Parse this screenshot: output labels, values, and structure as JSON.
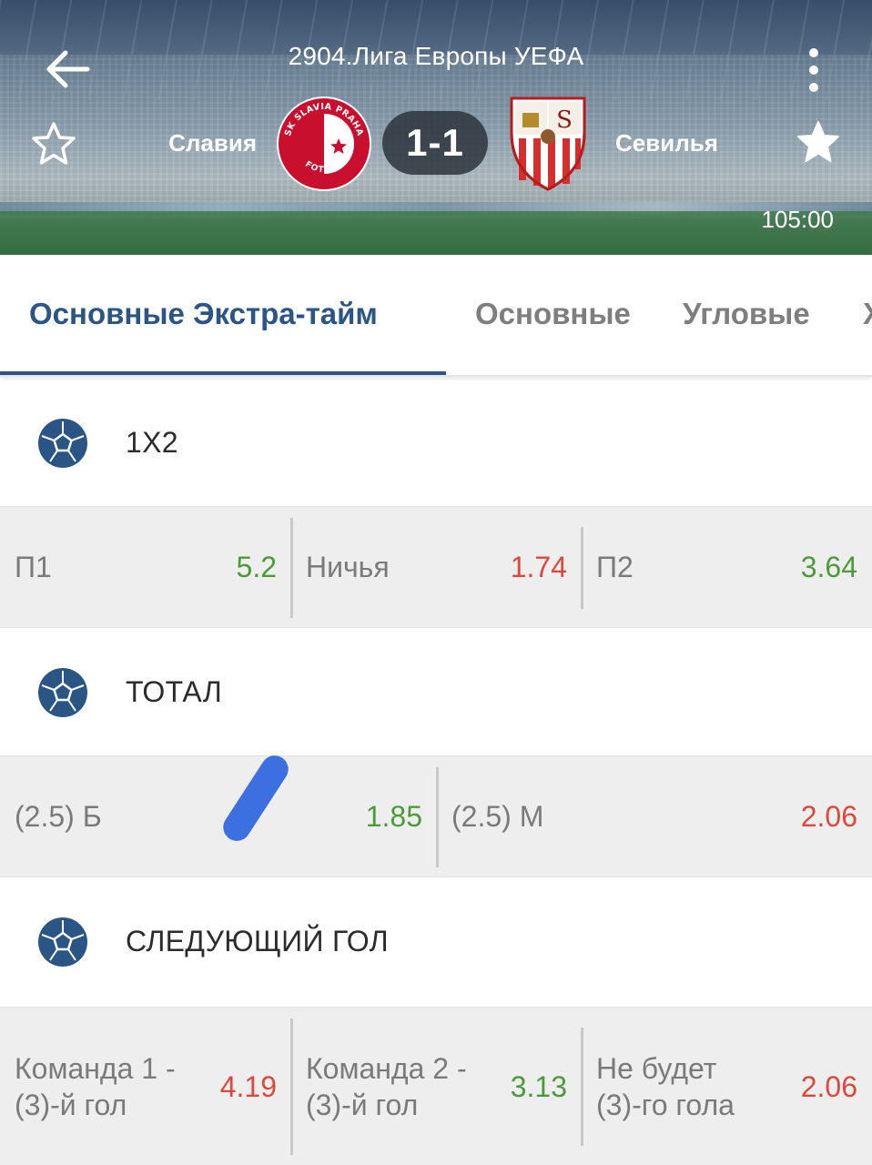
{
  "header": {
    "league": "2904.Лига Европы УЕФА",
    "home_team": "Славия",
    "away_team": "Севилья",
    "score": "1-1",
    "time": "105:00",
    "home_logo_text": "SK SLAVIA PRAHA FOTBAL"
  },
  "tabs": [
    {
      "label": "Основные Экстра-тайм",
      "active": true
    },
    {
      "label": "Основные",
      "active": false
    },
    {
      "label": "Угловые",
      "active": false
    },
    {
      "label": "Х",
      "active": false
    }
  ],
  "markets": [
    {
      "title": "1Х2",
      "outcomes": [
        {
          "label": "П1",
          "odd": "5.2",
          "trend": "up"
        },
        {
          "label": "Ничья",
          "odd": "1.74",
          "trend": "down"
        },
        {
          "label": "П2",
          "odd": "3.64",
          "trend": "up"
        }
      ]
    },
    {
      "title": "ТОТАЛ",
      "outcomes": [
        {
          "label": "(2.5) Б",
          "odd": "1.85",
          "trend": "up"
        },
        {
          "label": "(2.5) М",
          "odd": "2.06",
          "trend": "down"
        }
      ]
    },
    {
      "title": "СЛЕДУЮЩИЙ ГОЛ",
      "outcomes": [
        {
          "label_line1": "Команда 1 -",
          "label_line2": "(3)-й гол",
          "odd": "4.19",
          "trend": "down"
        },
        {
          "label_line1": "Команда 2 -",
          "label_line2": "(3)-й гол",
          "odd": "3.13",
          "trend": "up"
        },
        {
          "label_line1": "Не будет",
          "label_line2": "(3)-го гола",
          "odd": "2.06",
          "trend": "down"
        }
      ]
    }
  ],
  "colors": {
    "accent": "#2a5585",
    "odd_up": "#4d9a3c",
    "odd_down": "#d94a3d",
    "row_bg": "#eeeeee"
  },
  "icons": [
    "arrow-left-icon",
    "more-vertical-icon",
    "star-outline-icon",
    "star-filled-icon",
    "soccer-ball-icon"
  ]
}
